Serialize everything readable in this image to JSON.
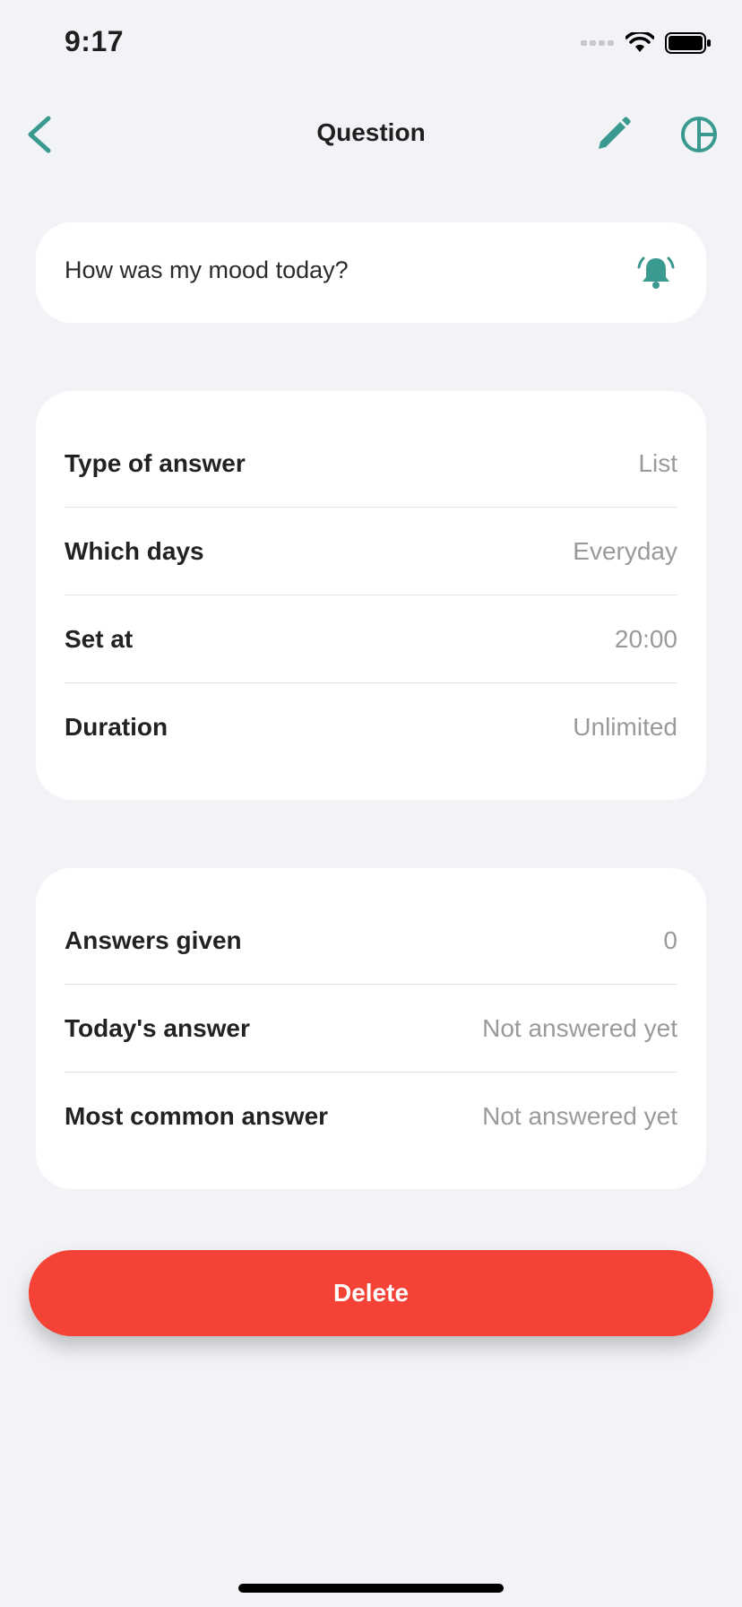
{
  "status_bar": {
    "time": "9:17"
  },
  "nav": {
    "title": "Question"
  },
  "colors": {
    "accent": "#3a9a8f",
    "danger": "#f44336",
    "background": "#f2f3f7"
  },
  "icons": {
    "back": "chevron-left-icon",
    "edit": "pencil-icon",
    "stats": "pie-chart-icon",
    "reminder": "bell-ringing-icon"
  },
  "question": {
    "text": "How was my mood today?"
  },
  "details": [
    {
      "label": "Type of answer",
      "value": "List"
    },
    {
      "label": "Which days",
      "value": "Everyday"
    },
    {
      "label": "Set at",
      "value": "20:00"
    },
    {
      "label": "Duration",
      "value": "Unlimited"
    }
  ],
  "stats": [
    {
      "label": "Answers given",
      "value": "0"
    },
    {
      "label": "Today's answer",
      "value": "Not answered yet"
    },
    {
      "label": "Most common answer",
      "value": "Not answered yet"
    }
  ],
  "actions": {
    "delete_label": "Delete"
  }
}
